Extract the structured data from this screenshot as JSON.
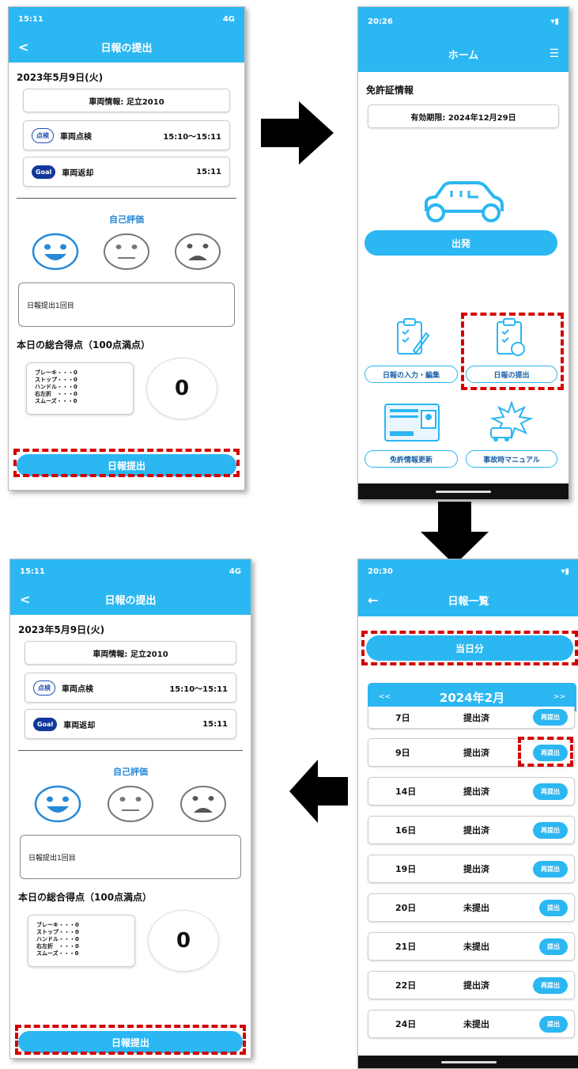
{
  "report_screen": {
    "status_time": "15:11",
    "status_signal": "4G",
    "title": "日報の提出",
    "date": "2023年5月9日(火)",
    "vehicle_info": "車両情報: 足立2010",
    "inspection_badge": "点検",
    "inspection_label": "車両点検",
    "inspection_time": "15:10〜15:11",
    "goal_badge": "Goal",
    "return_label": "車両返却",
    "return_time": "15:11",
    "self_eval_label": "自己評価",
    "comment": "日報提出1回目",
    "score_title": "本日の総合得点（100点満点）",
    "score_items": [
      "ブレーキ・・・0",
      "ストップ・・・0",
      "ハンドル・・・0",
      "右左折　・・・0",
      "スムーズ・・・0"
    ],
    "score": "0",
    "submit_label": "日報提出"
  },
  "home_screen": {
    "status_time": "20:26",
    "title": "ホーム",
    "license_label": "免許証情報",
    "expiry": "有効期限: 2024年12月29日",
    "depart_label": "出発",
    "menu": {
      "input_edit": "日報の入力・編集",
      "submit": "日報の提出",
      "license_update": "免許情報更新",
      "accident_manual": "事故時マニュアル"
    }
  },
  "list_screen": {
    "status_time": "20:30",
    "title": "日報一覧",
    "today_label": "当日分",
    "prev": "<<",
    "month": "2024年2月",
    "next": ">>",
    "rows": [
      {
        "day": "7日",
        "status": "提出済",
        "action": "再提出"
      },
      {
        "day": "9日",
        "status": "提出済",
        "action": "再提出"
      },
      {
        "day": "14日",
        "status": "提出済",
        "action": "再提出"
      },
      {
        "day": "16日",
        "status": "提出済",
        "action": "再提出"
      },
      {
        "day": "19日",
        "status": "提出済",
        "action": "再提出"
      },
      {
        "day": "20日",
        "status": "未提出",
        "action": "提出"
      },
      {
        "day": "21日",
        "status": "未提出",
        "action": "提出"
      },
      {
        "day": "22日",
        "status": "提出済",
        "action": "再提出"
      },
      {
        "day": "24日",
        "status": "未提出",
        "action": "提出"
      }
    ]
  },
  "colors": {
    "accent": "#2bb7f2",
    "highlight": "#d40000"
  }
}
